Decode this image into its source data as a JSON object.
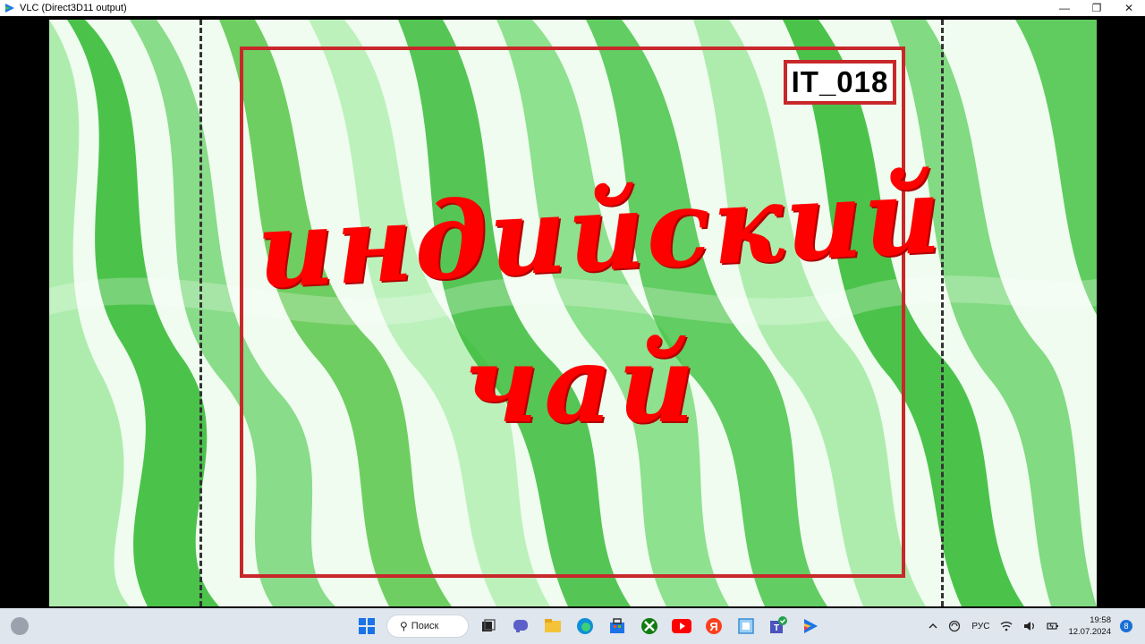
{
  "window": {
    "title": "VLC (Direct3D11 output)",
    "controls": [
      "minimize",
      "maximize",
      "close"
    ],
    "minimize_symbol": "—",
    "maximize_symbol": "❐",
    "close_symbol": "✕"
  },
  "video": {
    "badge_code": "IT_018",
    "title_line1": "индийский",
    "title_line2": "чай",
    "colors": {
      "title": "#ff0000",
      "border": "#c8282a",
      "background_greens": [
        "#2eb82e",
        "#6fd36f",
        "#a6eaa6",
        "#58c548"
      ]
    }
  },
  "taskbar": {
    "search_label": "Поиск",
    "pinned_icons": [
      "windows-start-icon",
      "search-icon",
      "task-view-icon",
      "chat-icon",
      "file-explorer-icon",
      "edge-browser-icon",
      "store-icon",
      "xbox-icon",
      "youtube-icon",
      "yandex-icon",
      "photo-app-icon",
      "teams-icon",
      "vlc-play-icon"
    ],
    "tray": {
      "language": "РУС",
      "time": "19:58",
      "date": "12.07.2024",
      "notification_count": "8"
    }
  }
}
